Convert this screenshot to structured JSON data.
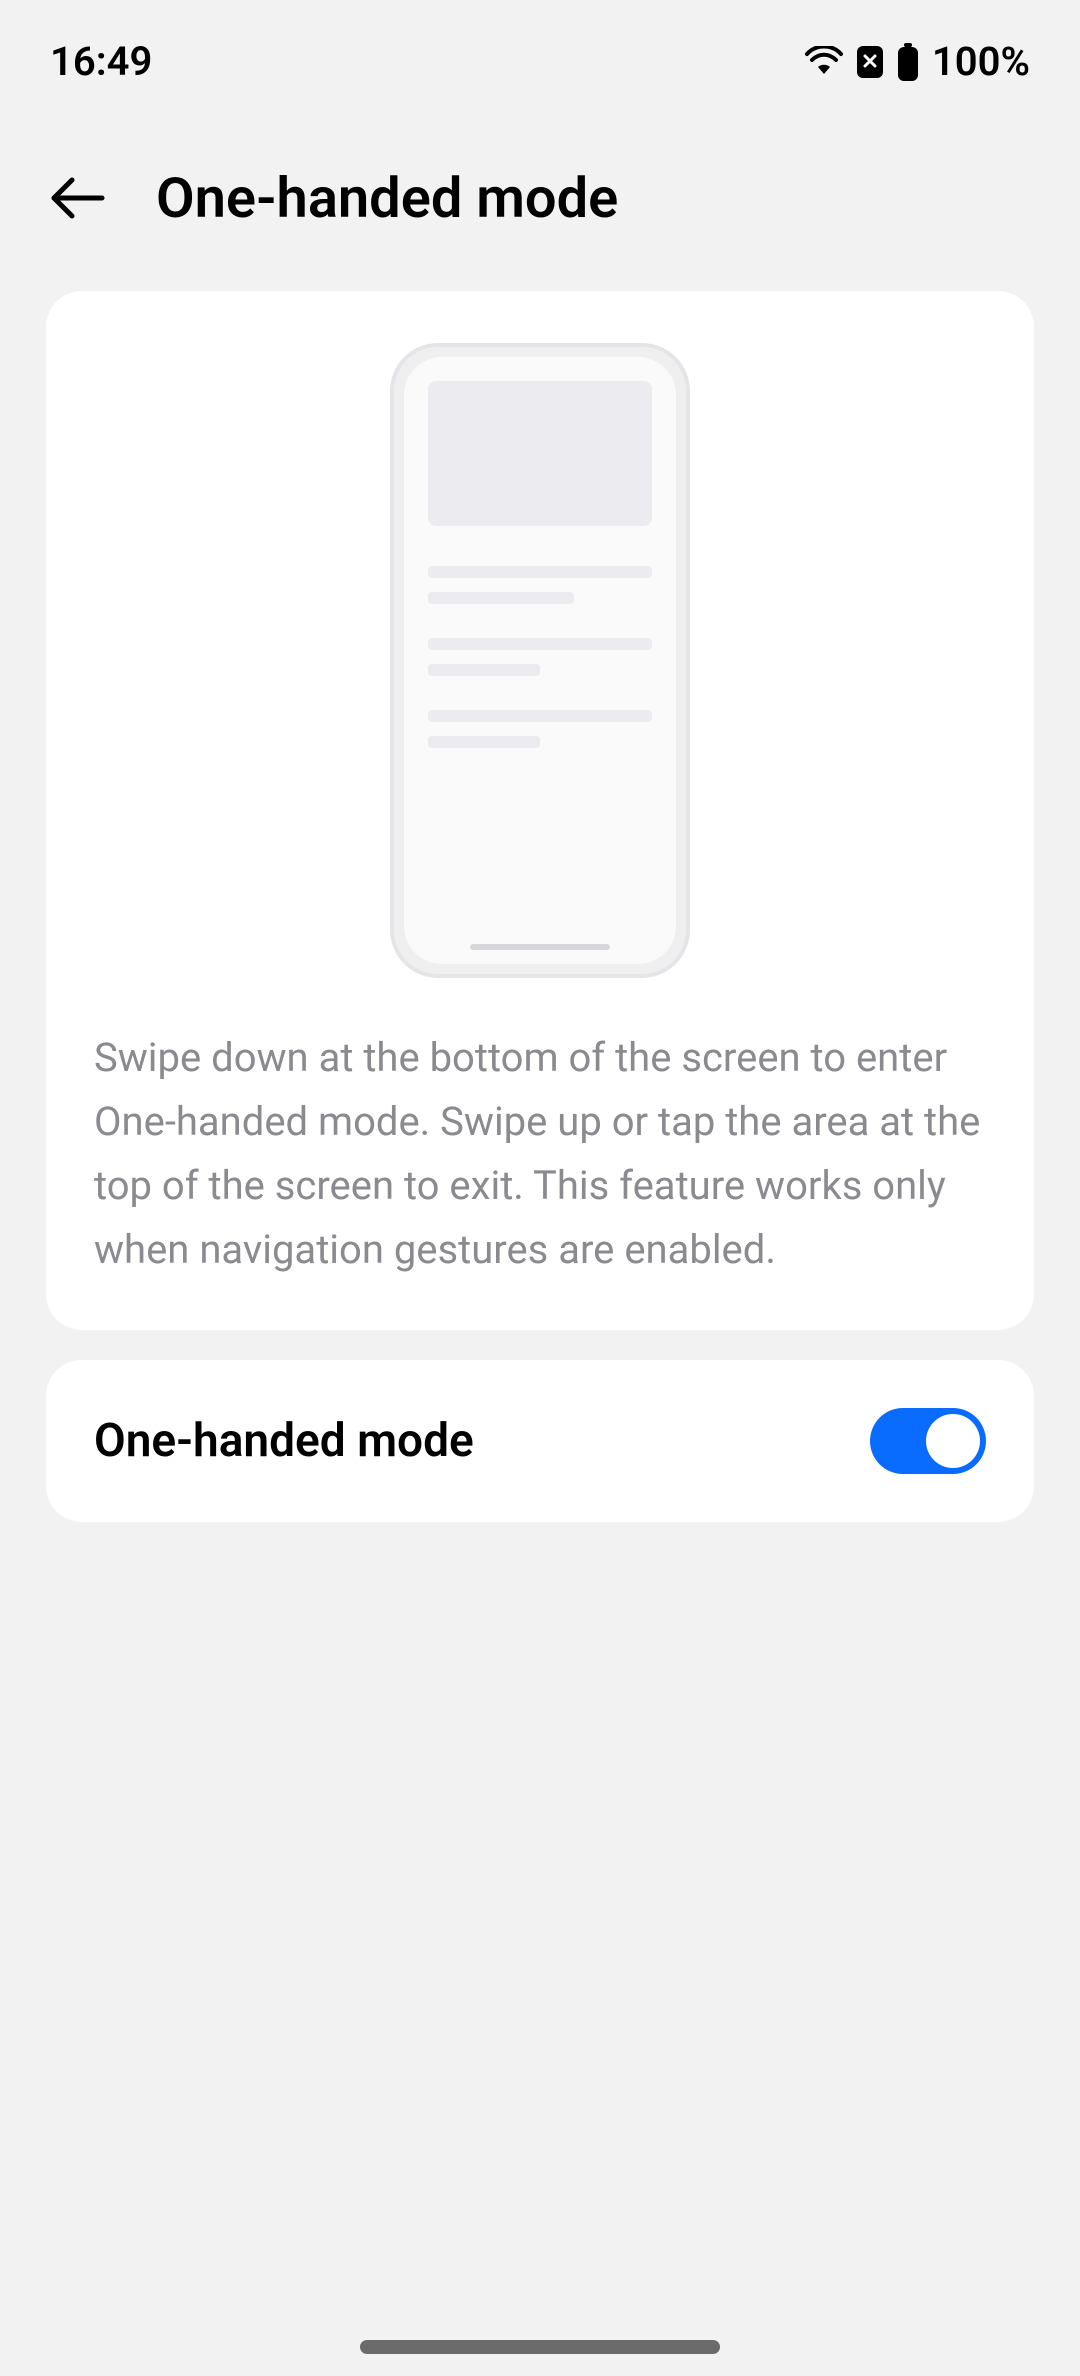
{
  "statusbar": {
    "time": "16:49",
    "battery_text": "100%"
  },
  "header": {
    "title": "One-handed mode"
  },
  "info": {
    "description": "Swipe down at the bottom of the screen to enter One-handed mode. Swipe up or tap the area at the top of the screen to exit. This feature works only when navigation gestures are enabled."
  },
  "toggle": {
    "label": "One-handed mode",
    "enabled": true
  }
}
